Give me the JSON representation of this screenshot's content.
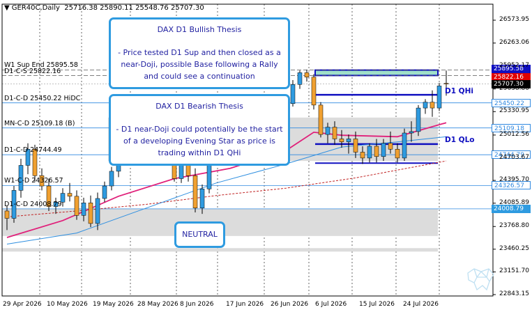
{
  "header": {
    "symbol": "GER40C,Daily",
    "ohlc": "25716.38 25890.11 25548.76 25707.30"
  },
  "level_labels": {
    "w1_sup": "W1 Sup End 25895.58",
    "d1_cs": "D1-C-S 25822.16",
    "d1_cd_hidc": "D1-C-D 25450.22 HiDC",
    "mn_cd": "MN-C-D 25109.18 (B)",
    "d1_cd": "D1-C-D 24744.49",
    "w1_c": "W1-C-D 24326.57",
    "d1_c": "D1-C-D 24008.79"
  },
  "bull_box": {
    "title": "DAX D1 Bullish Thesis",
    "body": "- Price tested D1 Sup and then closed as a near-Doji, possible Base following a Rally and could see a continuation"
  },
  "bear_box": {
    "title": "DAX D1 Bearish Thesis",
    "body": "- D1 near-Doji could potentially be the start of a developing Evening Star as price is trading within D1 QHi"
  },
  "neutral_box": {
    "label": "NEUTRAL"
  },
  "zone_labels": {
    "qhi": "D1 QHi",
    "qlo": "D1 QLo"
  },
  "price_tags": [
    {
      "text": "25895.58",
      "bg": "#1010c0",
      "fg": "#ffffff",
      "price": 25895.58
    },
    {
      "text": "25822.16",
      "bg": "#e00000",
      "fg": "#ffffff",
      "price": 25822.16
    },
    {
      "text": "25707.30",
      "bg": "#000000",
      "fg": "#ffffff",
      "price": 25707.3
    },
    {
      "text": "25450.22",
      "bg": "#ffffff",
      "fg": "#2f88e0",
      "price": 25450.22
    },
    {
      "text": "25109.18",
      "bg": "#ffffff",
      "fg": "#2f88e0",
      "price": 25109.18
    },
    {
      "text": "24744.79",
      "bg": "#ffffff",
      "fg": "#2f88e0",
      "price": 24744.79
    },
    {
      "text": "24326.57",
      "bg": "#ffffff",
      "fg": "#2f88e0",
      "price": 24326.57
    },
    {
      "text": "24008.79",
      "bg": "#2f9be0",
      "fg": "#ffffff",
      "price": 24008.79
    }
  ],
  "colors": {
    "bull": "#2f9be0",
    "bear": "#f0a030",
    "wick": "#000000",
    "ma_fast": "#e0207a",
    "ma_mid": "#2f8fe0",
    "ma_slow": "#c02020",
    "level_line": "#2f88e0",
    "zone": "#dcdcdc",
    "qzone": "#1010c0"
  },
  "chart_data": {
    "type": "candlestick",
    "symbol": "GER40C",
    "timeframe": "Daily",
    "ylim": [
      22843.15,
      26573.95
    ],
    "y_ticks": [
      "26573.95",
      "26263.06",
      "25952.17",
      "25638.80",
      "25330.95",
      "25012.56",
      "24703.67",
      "24395.70",
      "24085.89",
      "23768.80",
      "23460.25",
      "23151.70",
      "22843.15"
    ],
    "y_tick_values": [
      26573.95,
      26263.06,
      25952.17,
      25638.8,
      25330.95,
      25012.56,
      24703.67,
      24395.7,
      24085.89,
      23768.8,
      23460.25,
      23151.7,
      22843.15
    ],
    "x_ticks": [
      "29 Apr 2026",
      "10 May 2026",
      "19 May 2026",
      "28 May 2026",
      "8 Jun 2026",
      "17 Jun 2026",
      "26 Jun 2026",
      "6 Jul 2026",
      "15 Jul 2026",
      "24 Jul 2026"
    ],
    "levels": [
      {
        "name": "W1 Sup End",
        "price": 25895.58
      },
      {
        "name": "D1-C-S",
        "price": 25822.16
      },
      {
        "name": "D1-C-D HiDC",
        "price": 25450.22
      },
      {
        "name": "MN-C-D (B)",
        "price": 25109.18
      },
      {
        "name": "D1-C-D",
        "price": 24744.79
      },
      {
        "name": "W1-C-D",
        "price": 24326.57
      },
      {
        "name": "D1-C-D",
        "price": 24008.79
      }
    ],
    "zones": [
      {
        "name": "D1 QHi",
        "from": 25560,
        "to": 25890
      },
      {
        "name": "D1 QLo",
        "from": 24620,
        "to": 24900
      },
      {
        "name": "neutral grey",
        "from": 23640,
        "to": 24010
      }
    ],
    "candles": [
      {
        "o": 23980,
        "h": 24050,
        "l": 23720,
        "c": 23880
      },
      {
        "o": 23880,
        "h": 24320,
        "l": 23820,
        "c": 24260
      },
      {
        "o": 24260,
        "h": 24690,
        "l": 24160,
        "c": 24600
      },
      {
        "o": 24600,
        "h": 24900,
        "l": 24480,
        "c": 24820
      },
      {
        "o": 24820,
        "h": 24880,
        "l": 24380,
        "c": 24460
      },
      {
        "o": 24460,
        "h": 24560,
        "l": 24260,
        "c": 24320
      },
      {
        "o": 24320,
        "h": 24420,
        "l": 23980,
        "c": 24040
      },
      {
        "o": 24040,
        "h": 24160,
        "l": 23940,
        "c": 24100
      },
      {
        "o": 24100,
        "h": 24290,
        "l": 24040,
        "c": 24220
      },
      {
        "o": 24220,
        "h": 24360,
        "l": 24110,
        "c": 24180
      },
      {
        "o": 24180,
        "h": 24260,
        "l": 23860,
        "c": 23920
      },
      {
        "o": 23920,
        "h": 24160,
        "l": 23840,
        "c": 24090
      },
      {
        "o": 24090,
        "h": 24190,
        "l": 23760,
        "c": 23810
      },
      {
        "o": 23810,
        "h": 24230,
        "l": 23720,
        "c": 24150
      },
      {
        "o": 24150,
        "h": 24380,
        "l": 24100,
        "c": 24320
      },
      {
        "o": 24320,
        "h": 24580,
        "l": 24260,
        "c": 24520
      },
      {
        "o": 24520,
        "h": 24740,
        "l": 24440,
        "c": 24700
      },
      {
        "o": 24700,
        "h": 24900,
        "l": 24620,
        "c": 24850
      },
      {
        "o": 24850,
        "h": 24960,
        "l": 24720,
        "c": 24780
      },
      {
        "o": 24780,
        "h": 24980,
        "l": 24700,
        "c": 24930
      },
      {
        "o": 24930,
        "h": 25040,
        "l": 24780,
        "c": 24860
      },
      {
        "o": 24860,
        "h": 25020,
        "l": 24800,
        "c": 24950
      },
      {
        "o": 24950,
        "h": 25080,
        "l": 24820,
        "c": 24880
      },
      {
        "o": 24880,
        "h": 24940,
        "l": 24600,
        "c": 24660
      },
      {
        "o": 24660,
        "h": 24760,
        "l": 24380,
        "c": 24420
      },
      {
        "o": 24420,
        "h": 24660,
        "l": 24360,
        "c": 24600
      },
      {
        "o": 24600,
        "h": 24660,
        "l": 24380,
        "c": 24460
      },
      {
        "o": 24460,
        "h": 24560,
        "l": 23960,
        "c": 24020
      },
      {
        "o": 24020,
        "h": 24340,
        "l": 23940,
        "c": 24280
      },
      {
        "o": 24280,
        "h": 24760,
        "l": 24220,
        "c": 24700
      },
      {
        "o": 24700,
        "h": 24980,
        "l": 24640,
        "c": 24920
      },
      {
        "o": 24920,
        "h": 25060,
        "l": 24820,
        "c": 24980
      },
      {
        "o": 24980,
        "h": 25100,
        "l": 24860,
        "c": 24900
      },
      {
        "o": 24900,
        "h": 25060,
        "l": 24800,
        "c": 25020
      },
      {
        "o": 25020,
        "h": 25120,
        "l": 24880,
        "c": 24940
      },
      {
        "o": 24940,
        "h": 25000,
        "l": 24740,
        "c": 24800
      },
      {
        "o": 24800,
        "h": 25000,
        "l": 24720,
        "c": 24940
      },
      {
        "o": 24940,
        "h": 25100,
        "l": 24880,
        "c": 25060
      },
      {
        "o": 25060,
        "h": 25120,
        "l": 24720,
        "c": 24760
      },
      {
        "o": 24760,
        "h": 25100,
        "l": 24700,
        "c": 25040
      },
      {
        "o": 25040,
        "h": 25500,
        "l": 24980,
        "c": 25440
      },
      {
        "o": 25440,
        "h": 25760,
        "l": 25400,
        "c": 25700
      },
      {
        "o": 25700,
        "h": 25890,
        "l": 25640,
        "c": 25860
      },
      {
        "o": 25860,
        "h": 25900,
        "l": 25740,
        "c": 25800
      },
      {
        "o": 25800,
        "h": 25840,
        "l": 25360,
        "c": 25420
      },
      {
        "o": 25420,
        "h": 25460,
        "l": 24980,
        "c": 25020
      },
      {
        "o": 25020,
        "h": 25180,
        "l": 24900,
        "c": 25120
      },
      {
        "o": 25120,
        "h": 25200,
        "l": 24880,
        "c": 24960
      },
      {
        "o": 24960,
        "h": 25080,
        "l": 24840,
        "c": 24920
      },
      {
        "o": 24920,
        "h": 25020,
        "l": 24760,
        "c": 24960
      },
      {
        "o": 24960,
        "h": 25060,
        "l": 24700,
        "c": 24780
      },
      {
        "o": 24780,
        "h": 24860,
        "l": 24620,
        "c": 24700
      },
      {
        "o": 24700,
        "h": 24900,
        "l": 24640,
        "c": 24860
      },
      {
        "o": 24860,
        "h": 24960,
        "l": 24640,
        "c": 24720
      },
      {
        "o": 24720,
        "h": 24960,
        "l": 24660,
        "c": 24900
      },
      {
        "o": 24900,
        "h": 25060,
        "l": 24760,
        "c": 24820
      },
      {
        "o": 24820,
        "h": 24900,
        "l": 24640,
        "c": 24700
      },
      {
        "o": 24700,
        "h": 25100,
        "l": 24660,
        "c": 25040
      },
      {
        "o": 25040,
        "h": 25200,
        "l": 24920,
        "c": 25060
      },
      {
        "o": 25060,
        "h": 25420,
        "l": 25000,
        "c": 25380
      },
      {
        "o": 25380,
        "h": 25500,
        "l": 25300,
        "c": 25460
      },
      {
        "o": 25460,
        "h": 25620,
        "l": 25260,
        "c": 25380
      },
      {
        "o": 25380,
        "h": 25720,
        "l": 25340,
        "c": 25680
      },
      {
        "o": 25716,
        "h": 25890,
        "l": 25548,
        "c": 25707
      }
    ],
    "ma_fast_points": [
      [
        0,
        23620
      ],
      [
        8,
        23850
      ],
      [
        16,
        24180
      ],
      [
        24,
        24420
      ],
      [
        32,
        24560
      ],
      [
        40,
        24800
      ],
      [
        44,
        25050
      ],
      [
        48,
        25010
      ],
      [
        56,
        24990
      ],
      [
        63,
        25180
      ]
    ],
    "ma_mid_points": [
      [
        0,
        23530
      ],
      [
        10,
        23680
      ],
      [
        20,
        24020
      ],
      [
        30,
        24360
      ],
      [
        40,
        24620
      ],
      [
        48,
        24850
      ],
      [
        56,
        24920
      ],
      [
        63,
        24990
      ]
    ],
    "ma_slow_points": [
      [
        0,
        23900
      ],
      [
        10,
        23980
      ],
      [
        20,
        24070
      ],
      [
        30,
        24190
      ],
      [
        40,
        24290
      ],
      [
        50,
        24430
      ],
      [
        63,
        24660
      ]
    ]
  }
}
